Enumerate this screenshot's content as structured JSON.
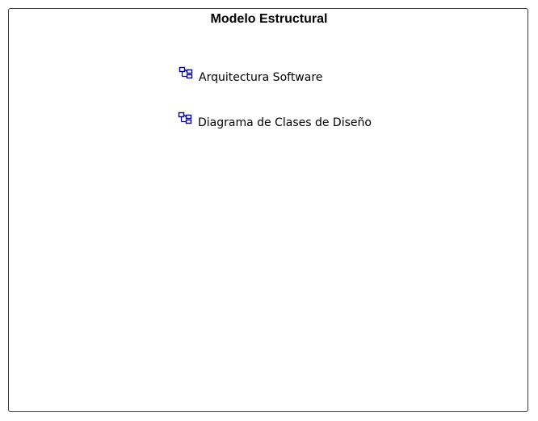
{
  "package": {
    "title": "Modelo Estructural",
    "links": [
      {
        "label": "Arquitectura Software",
        "icon": "diagram-icon"
      },
      {
        "label": "Diagrama de Clases de Diseño",
        "icon": "diagram-icon"
      }
    ]
  },
  "colors": {
    "border": "#3a3a3a",
    "icon_stroke": "#00007a",
    "text": "#000000"
  }
}
